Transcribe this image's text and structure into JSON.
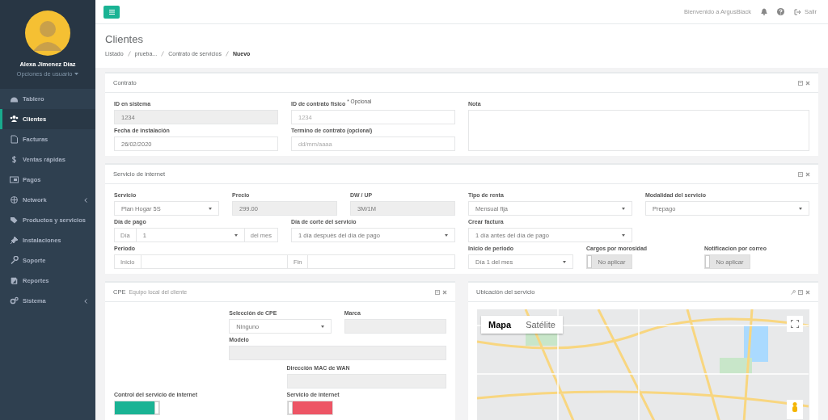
{
  "sidebar": {
    "user": {
      "name": "Alexa Jimenez Díaz",
      "menu": "Opciones de usuario"
    },
    "items": [
      {
        "label": "Tablero",
        "selected": false,
        "expandable": false
      },
      {
        "label": "Clientes",
        "selected": true,
        "expandable": false
      },
      {
        "label": "Facturas",
        "selected": false,
        "expandable": false
      },
      {
        "label": "Ventas rápidas",
        "selected": false,
        "expandable": false
      },
      {
        "label": "Pagos",
        "selected": false,
        "expandable": false
      },
      {
        "label": "Network",
        "selected": false,
        "expandable": true
      },
      {
        "label": "Productos y servicios",
        "selected": false,
        "expandable": false
      },
      {
        "label": "Instalaciones",
        "selected": false,
        "expandable": false
      },
      {
        "label": "Soporte",
        "selected": false,
        "expandable": false
      },
      {
        "label": "Reportes",
        "selected": false,
        "expandable": false
      },
      {
        "label": "Sistema",
        "selected": false,
        "expandable": true
      }
    ]
  },
  "topbar": {
    "welcome": "Bienvenido a ArgusBlack",
    "logout": "Salir"
  },
  "header": {
    "title": "Clientes",
    "breadcrumb": [
      {
        "label": "Listado",
        "current": false
      },
      {
        "label": "prueba...",
        "current": false
      },
      {
        "label": "Contrato de servicios",
        "current": false
      },
      {
        "label": "Nuevo",
        "current": true
      }
    ]
  },
  "panels": [
    {
      "title": "Contrato",
      "fields": [
        {
          "kind": "input",
          "label": "ID en sistema",
          "value": "1234",
          "disabled": true
        },
        {
          "kind": "input",
          "label": "ID de contrato físico $^{* Opcional}$",
          "placeholder": "1234",
          "disabled": false
        },
        {
          "kind": "textarea",
          "label": "Nota",
          "disabled": false
        },
        {
          "kind": "input",
          "label": "Fecha de instalación",
          "value": "26/02/2020",
          "disabled": false
        },
        {
          "kind": "input",
          "label": "Termino de contrato",
          "hint": "(opcional)",
          "placeholder": "dd/mm/aaaa",
          "disabled": false
        }
      ]
    },
    {
      "title": "Servicio de internet",
      "fields": [
        {
          "kind": "select",
          "label": "Servicio",
          "value": "Plan Hogar 5S",
          "disabled": false
        },
        {
          "kind": "input",
          "label": "Precio",
          "value": "299.00",
          "disabled": true
        },
        {
          "kind": "input",
          "label": "DW / UP",
          "value": "3M/1M",
          "disabled": true
        },
        {
          "kind": "select",
          "label": "Tipo de renta",
          "value": "Mensual fija",
          "disabled": false
        },
        {
          "kind": "select",
          "label": "Modalidad del servicio",
          "value": "Prepago",
          "disabled": false
        },
        {
          "kind": "group",
          "label": "Día de pago",
          "disabled": false,
          "parts": [
            {
              "kind": "addon",
              "text": "Día"
            },
            {
              "kind": "select",
              "value": "1"
            },
            {
              "kind": "addon",
              "text": "del mes"
            }
          ]
        },
        {
          "kind": "select",
          "label": "Día de corte del servicio",
          "value": "1 día después del día de pago",
          "disabled": false
        },
        {
          "kind": "select",
          "label": "Crear factura",
          "value": "1 día antes del día de pago",
          "disabled": false
        },
        {
          "kind": "group",
          "label": "Periodo",
          "disabled": false,
          "parts": [
            {
              "kind": "addon",
              "text": "Inicio"
            },
            {
              "kind": "input"
            },
            {
              "kind": "addon",
              "text": "Fin"
            },
            {
              "kind": "input"
            }
          ]
        },
        {
          "kind": "select",
          "label": "Inicio de periodo",
          "value": "Día 1 del mes",
          "disabled": false
        },
        {
          "kind": "toggle",
          "label": "Cargos por morosidad",
          "on": false,
          "color": "#e4e4e4",
          "text": "No aplicar",
          "disabled": false
        },
        {
          "kind": "toggle",
          "label": "Notificacion por correo",
          "on": false,
          "color": "#e4e4e4",
          "text": "No aplicar",
          "disabled": false
        }
      ]
    },
    {
      "title": "CPE",
      "subtitle": "Equipo local del cliente",
      "fields": [
        {
          "kind": "select",
          "label": "Selección de CPE",
          "value": "Ninguno",
          "disabled": false
        },
        {
          "kind": "input",
          "label": "Marca",
          "disabled": true
        },
        {
          "kind": "input",
          "label": "Modelo",
          "disabled": true
        },
        {
          "kind": "input",
          "label": "Dirección MAC de WAN",
          "disabled": true
        },
        {
          "kind": "toggle",
          "label": "Control del servicio de internet",
          "on": true,
          "color": "#1ab394",
          "disabled": false
        },
        {
          "kind": "toggle",
          "label": "Servicio de internet",
          "on": false,
          "color": "#ed5565",
          "disabled": false
        }
      ]
    }
  ],
  "map_panel": {
    "title": "Ubicación del servicio",
    "map_types": [
      {
        "label": "Mapa",
        "selected": true
      },
      {
        "label": "Satélite",
        "selected": false
      }
    ]
  }
}
